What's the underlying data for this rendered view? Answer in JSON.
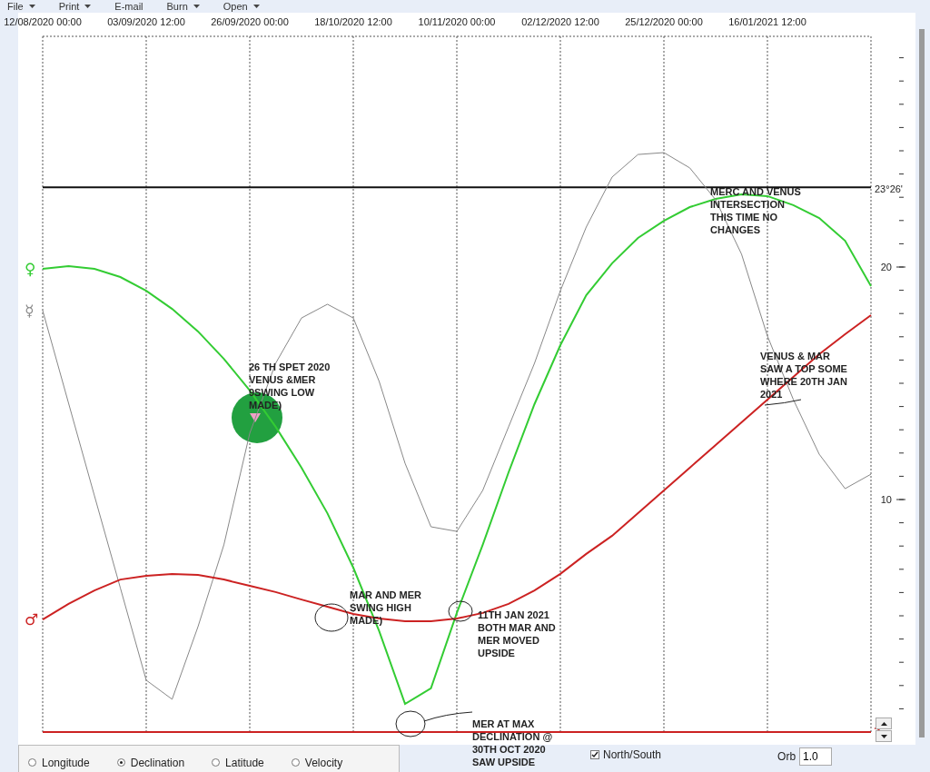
{
  "menu": [
    {
      "label": "File",
      "dropdown": true
    },
    {
      "label": "Print",
      "dropdown": true
    },
    {
      "label": "E-mail",
      "dropdown": false
    },
    {
      "label": "Burn",
      "dropdown": true
    },
    {
      "label": "Open",
      "dropdown": true
    }
  ],
  "chart": {
    "chart_data": {
      "type": "line",
      "grid": true,
      "ylim": [
        0,
        30
      ],
      "yticks": [
        10,
        20,
        {
          "value": 23.43,
          "label": "23°26'"
        }
      ],
      "ref_lines": [
        {
          "axis": "y",
          "value": 23.43,
          "color": "#111111"
        }
      ],
      "categories": [
        "12/08/2020 00:00",
        null,
        null,
        null,
        "03/09/2020 12:00",
        null,
        null,
        null,
        "26/09/2020 00:00",
        null,
        null,
        null,
        "18/10/2020 12:00",
        null,
        null,
        null,
        "10/11/2020 00:00",
        null,
        null,
        null,
        "02/12/2020 12:00",
        null,
        null,
        null,
        "25/12/2020 00:00",
        null,
        null,
        null,
        "16/01/2021 12:00",
        null,
        null,
        null,
        null
      ],
      "series": [
        {
          "name": "♀",
          "color": "#33cc33",
          "values": [
            19.92,
            20.04,
            19.92,
            19.57,
            18.98,
            18.2,
            17.23,
            16.05,
            14.69,
            13.13,
            11.37,
            9.41,
            7.07,
            4.34,
            1.21,
            1.88,
            5.12,
            8.05,
            11.17,
            14.1,
            16.64,
            18.79,
            20.16,
            21.25,
            21.99,
            22.58,
            22.93,
            23.13,
            23.05,
            22.66,
            22.11,
            21.13,
            19.18
          ]
        },
        {
          "name": "☿",
          "color": "#888888",
          "values": [
            18.13,
            14.14,
            10.16,
            6.2,
            2.23,
            1.41,
            4.53,
            8.05,
            12.85,
            15.86,
            17.81,
            18.4,
            17.81,
            15.08,
            11.56,
            8.83,
            8.63,
            10.39,
            13.13,
            15.86,
            18.98,
            21.72,
            23.87,
            24.84,
            24.92,
            24.26,
            22.89,
            20.55,
            17.03,
            14.3,
            11.95,
            10.47,
            11.09
          ]
        },
        {
          "name": "♂",
          "color": "#cc2222",
          "values": [
            4.84,
            5.51,
            6.09,
            6.56,
            6.72,
            6.8,
            6.76,
            6.56,
            6.29,
            6.02,
            5.7,
            5.39,
            5.08,
            4.88,
            4.77,
            4.77,
            4.88,
            5.12,
            5.51,
            6.09,
            6.8,
            7.66,
            8.44,
            9.41,
            10.39,
            11.37,
            12.34,
            13.32,
            14.3,
            15.27,
            16.25,
            17.11,
            17.93
          ]
        }
      ],
      "annotations": [
        "MERC AND VENUS INTERSECTION THIS TIME NO CHANGES",
        "26 TH SPET 2020 VENUS &MER 9SWING LOW MADE)",
        "VENUS & MAR SAW A TOP SOME WHERE 20TH JAN 2021",
        "MAR AND MER SWING HIGH MADE)",
        "11TH JAN 2021 BOTH MAR AND MER MOVED UPSIDE",
        "MER AT MAX DECLINATION @ 30TH OCT 2020 SAW UPSIDE"
      ]
    }
  },
  "modes": [
    {
      "label": "Longitude",
      "selected": false
    },
    {
      "label": "Declination",
      "selected": true
    },
    {
      "label": "Latitude",
      "selected": false
    },
    {
      "label": "Velocity",
      "selected": false
    }
  ],
  "north_south": {
    "label": "North/South",
    "checked": true
  },
  "orb": {
    "label": "Orb",
    "value": "1.0"
  }
}
